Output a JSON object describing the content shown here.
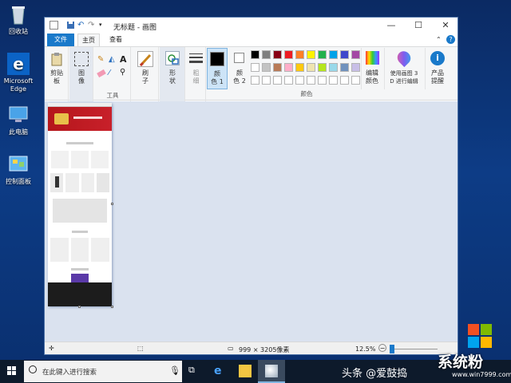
{
  "desktop": {
    "icons": [
      {
        "label": "回收站"
      },
      {
        "label": "Microsoft Edge"
      },
      {
        "label": "此电脑"
      },
      {
        "label": "控制面板"
      }
    ]
  },
  "window": {
    "title": "无标题 - 画图",
    "tabs": {
      "file": "文件",
      "home": "主页",
      "view": "查看"
    },
    "ribbon": {
      "clipboard": {
        "paste": "剪贴",
        "paste2": "板"
      },
      "image": {
        "label": "图",
        "label2": "像"
      },
      "tools_group": "工具",
      "brush": {
        "label": "刷",
        "label2": "子"
      },
      "shapes": {
        "label": "形",
        "label2": "状"
      },
      "size": {
        "label": "粗",
        "label2": "细"
      },
      "color1": {
        "label": "颜",
        "label2": "色 1"
      },
      "color2": {
        "label": "颜",
        "label2": "色 2"
      },
      "colors_group": "颜色",
      "edit_colors": {
        "label": "编辑",
        "label2": "颜色"
      },
      "paint3d": {
        "label": "使用画图 3",
        "label2": "D 进行编辑"
      },
      "product": {
        "label": "产品",
        "label2": "提醒"
      }
    },
    "palette": [
      "#000000",
      "#7f7f7f",
      "#880015",
      "#ed1c24",
      "#ff7f27",
      "#fff200",
      "#22b14c",
      "#00a2e8",
      "#3f48cc",
      "#a349a4",
      "#ffffff",
      "#c3c3c3",
      "#b97a57",
      "#ffaec9",
      "#ffc90e",
      "#efe4b0",
      "#b5e61d",
      "#99d9ea",
      "#7092be",
      "#c8bfe7"
    ],
    "status": {
      "dimensions": "999 × 3205像素",
      "zoom": "12.5%"
    }
  },
  "taskbar": {
    "search_placeholder": "在此键入进行搜索",
    "watermark": "头条 @爱鼓捣",
    "brand": "系统粉",
    "url": "www.win7999.com"
  }
}
